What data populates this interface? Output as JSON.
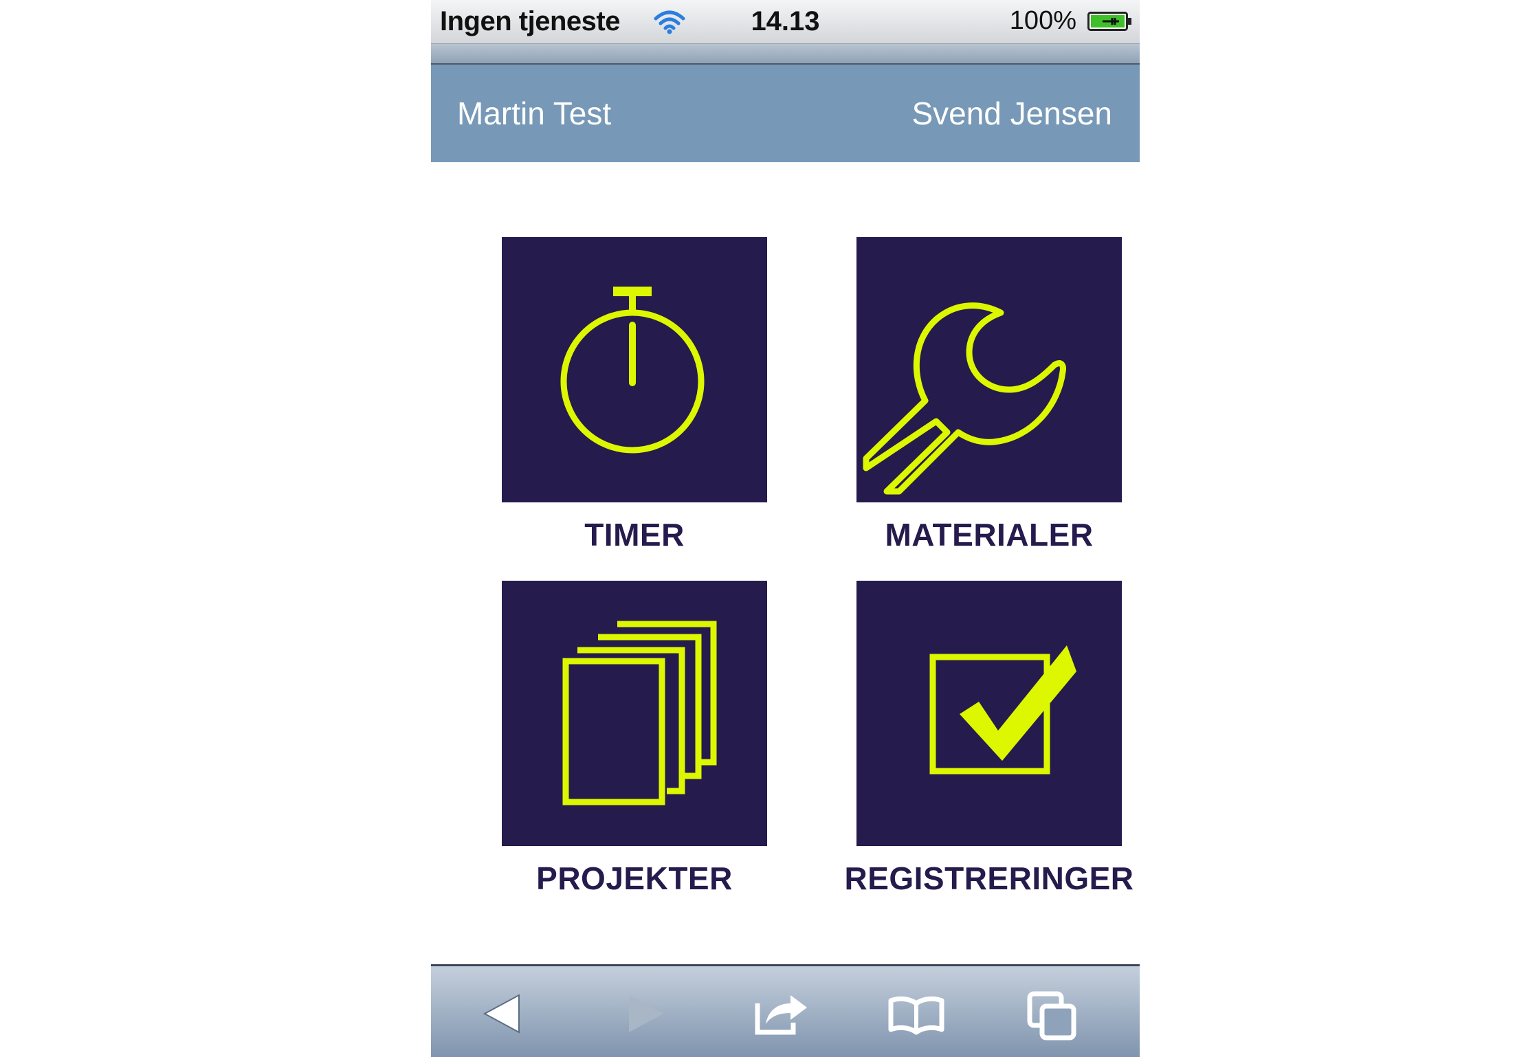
{
  "status_bar": {
    "carrier": "Ingen tjeneste",
    "time": "14.13",
    "battery": "100%"
  },
  "header": {
    "user": "Martin Test",
    "customer": "Svend Jensen"
  },
  "tiles": [
    {
      "label": "TIMER",
      "icon": "stopwatch-icon"
    },
    {
      "label": "MATERIALER",
      "icon": "wrench-icon"
    },
    {
      "label": "PROJEKTER",
      "icon": "documents-icon"
    },
    {
      "label": "REGISTRERINGER",
      "icon": "checkbox-icon"
    }
  ],
  "toolbar": {
    "icons": [
      "back-arrow-icon",
      "forward-arrow-icon",
      "share-icon",
      "bookmarks-icon",
      "tabs-icon"
    ]
  },
  "colors": {
    "header_bg": "#7799b7",
    "tile_bg": "#251b4d",
    "icon_accent": "#dcf700",
    "label_color": "#251b4d"
  }
}
